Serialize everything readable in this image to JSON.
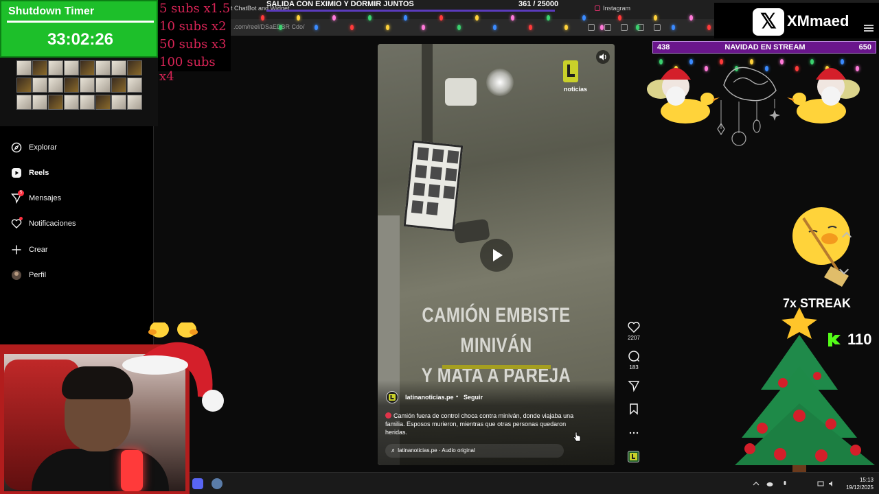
{
  "timer": {
    "title": "Shutdown Timer",
    "value": "33:02:26"
  },
  "subs_rules": [
    "5 subs x1.5",
    "10 subs x2",
    "50 subs x3",
    "100 subs x4"
  ],
  "browser": {
    "stream_title": "SALIDA CON EXIMIO Y DORMIR JUNTOS",
    "stream_count": "361 / 25000",
    "tabs": [
      "t ChatBot and Widget",
      "Instagram"
    ],
    "url": ".com/reel/DSaEDBR Cdo/"
  },
  "xmmaed": {
    "label": "XMmaed"
  },
  "sidebar": {
    "items": [
      {
        "label": "Explorar",
        "icon": "compass-icon"
      },
      {
        "label": "Reels",
        "icon": "reels-icon"
      },
      {
        "label": "Mensajes",
        "icon": "messages-icon",
        "badge": "5"
      },
      {
        "label": "Notificaciones",
        "icon": "heart-icon"
      },
      {
        "label": "Crear",
        "icon": "plus-icon"
      },
      {
        "label": "Perfil",
        "icon": "avatar-icon"
      }
    ]
  },
  "reel": {
    "brand_label": "noticias",
    "headline_line1": "CAMIÓN EMBISTE MINIVÁN",
    "headline_line2": "Y MATA A PAREJA",
    "account_name": "latinanoticias.pe",
    "follow_separator": "•",
    "follow_label": "Seguir",
    "caption": "Camión fuera de control choca contra miniván, donde viajaba una familia. Esposos murieron, mientras que otras personas quedaron heridas.",
    "audio": "latinanoticias.pe · Audio original",
    "likes": "2207",
    "comments": "183"
  },
  "overlay": {
    "navidad_left": "438",
    "navidad_title": "NAVIDAD EN STREAM",
    "navidad_right": "650",
    "streak": "7x STREAK",
    "kick_count": "110"
  },
  "taskbar": {
    "time": "15:13",
    "date": "19/12/2025"
  },
  "colors": {
    "timer_green": "#1dbf2a",
    "subs_red": "#d82456",
    "navidad_purple": "#6a168c",
    "kick_green": "#53fc18"
  }
}
